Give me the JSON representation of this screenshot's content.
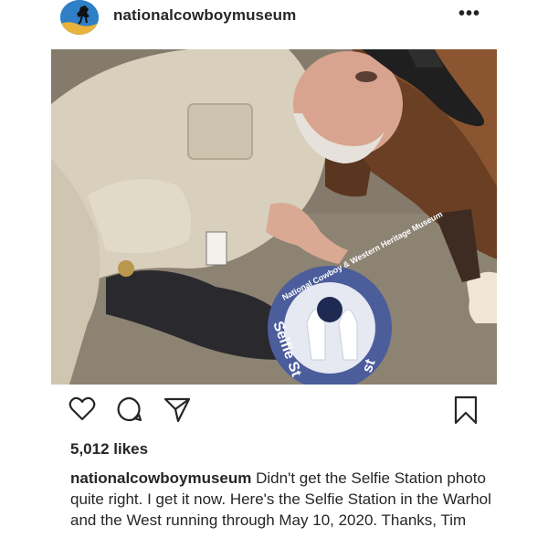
{
  "post": {
    "username": "nationalcowboymuseum",
    "more_label": "•••",
    "photo": {
      "sticker_text_top": "National Cowboy & Western Heritage Museum",
      "sticker_text_left": "Selfie St",
      "sticker_text_right": "st"
    },
    "actions": {
      "like_icon": "heart-icon",
      "comment_icon": "comment-icon",
      "share_icon": "share-icon",
      "save_icon": "bookmark-icon"
    },
    "likes": "5,012 likes",
    "caption": {
      "username": "nationalcowboymuseum",
      "text": "Didn't get the Selfie Station photo quite right. I get it now. Here's the Selfie Station in the Warhol and the West running through May 10, 2020. Thanks, Tim"
    }
  },
  "colors": {
    "text": "#262626",
    "avatar_blue": "#2f7fc6",
    "avatar_gold": "#e9b23a"
  }
}
